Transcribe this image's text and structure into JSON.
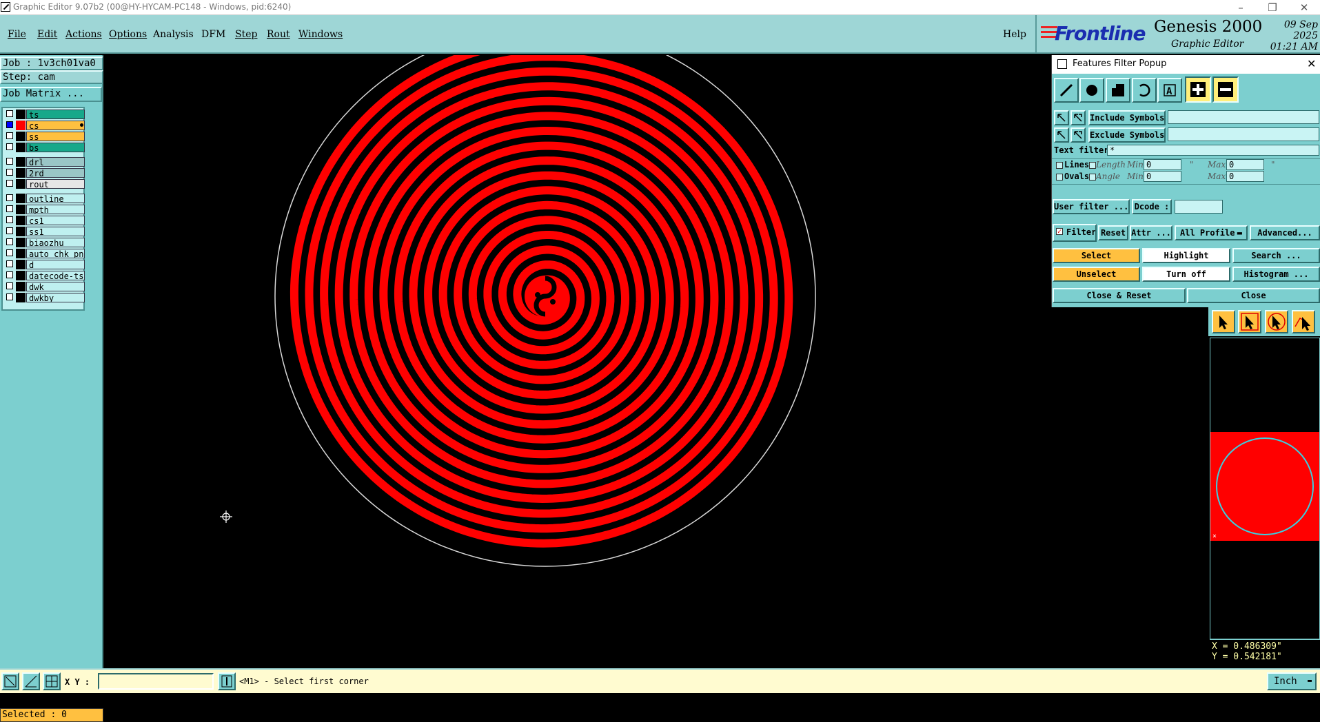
{
  "window": {
    "title": "Graphic Editor 9.07b2 (00@HY-HYCAM-PC148 - Windows, pid:6240)",
    "controls": [
      "–",
      "❐",
      "✕"
    ]
  },
  "menubar": {
    "items": [
      "File",
      "Edit",
      "Actions",
      "Options",
      "Analysis",
      "DFM",
      "Step",
      "Rout",
      "Windows"
    ],
    "help": "Help"
  },
  "logo": {
    "brand": "Frontline",
    "product": "Genesis 2000",
    "subtitle": "Graphic Editor",
    "date": "09 Sep 2025",
    "time": "01:21 AM"
  },
  "job": {
    "job_label": "Job : 1v3ch01va0",
    "step_label": "Step: cam",
    "matrix_button": "Job Matrix ..."
  },
  "layers": [
    {
      "name": "ts",
      "color": "#17a88a",
      "checked": false,
      "group": 0
    },
    {
      "name": "cs",
      "color": "#ffc040",
      "checked": true,
      "work": true,
      "group": 0
    },
    {
      "name": "ss",
      "color": "#ffc040",
      "checked": false,
      "group": 0
    },
    {
      "name": "bs",
      "color": "#17a88a",
      "checked": false,
      "group": 0
    },
    {
      "name": "drl",
      "color": "#9ac6c6",
      "checked": false,
      "group": 1
    },
    {
      "name": "2rd",
      "color": "#9ac6c6",
      "checked": false,
      "group": 1
    },
    {
      "name": "rout",
      "color": "#e6e6e6",
      "checked": false,
      "group": 1
    },
    {
      "name": "outline",
      "color": "#bff0f0",
      "checked": false,
      "group": 2
    },
    {
      "name": "mpth",
      "color": "#bff0f0",
      "checked": false,
      "group": 2
    },
    {
      "name": "cs1",
      "color": "#bff0f0",
      "checked": false,
      "group": 2
    },
    {
      "name": "ss1",
      "color": "#bff0f0",
      "checked": false,
      "group": 2
    },
    {
      "name": "biaozhu",
      "color": "#bff0f0",
      "checked": false,
      "group": 2
    },
    {
      "name": "auto_chk_pn",
      "color": "#bff0f0",
      "checked": false,
      "group": 2
    },
    {
      "name": "d",
      "color": "#bff0f0",
      "checked": false,
      "group": 2
    },
    {
      "name": "datecode-ts",
      "color": "#bff0f0",
      "checked": false,
      "group": 2
    },
    {
      "name": "dwk",
      "color": "#bff0f0",
      "checked": false,
      "group": 2
    },
    {
      "name": "dwkby",
      "color": "#bff0f0",
      "checked": false,
      "group": 2
    }
  ],
  "selected_label": "Selected : 0",
  "features_filter": {
    "title": "Features Filter Popup",
    "feature_types": [
      "line-icon",
      "pad-icon",
      "surface-icon",
      "arc-icon",
      "text-icon"
    ],
    "polarity": [
      "plus-icon",
      "minus-icon"
    ],
    "include_symbols_label": "Include Symbols :",
    "include_symbols_value": "",
    "exclude_symbols_label": "Exclude Symbols :",
    "exclude_symbols_value": "",
    "text_filter_label": "Text filter",
    "text_filter_value": "*",
    "lines_label": "Lines",
    "ovals_label": "Ovals",
    "length_label": "Length",
    "angle_label": "Angle",
    "min_label": "Min:",
    "max_label": "Max:",
    "length_min": "0",
    "length_max": "0",
    "angle_min": "0",
    "angle_max": "0",
    "inch_mark": "\"",
    "user_filter": "User filter ...",
    "dcode_label": "Dcode :",
    "dcode_value": "",
    "filter_label": "Filter",
    "filter_checked": true,
    "reset": "Reset",
    "attr": "Attr ...",
    "profile": "All Profile",
    "advanced": "Advanced...",
    "select": "Select",
    "highlight": "Highlight",
    "search": "Search ...",
    "unselect": "Unselect",
    "turn_off": "Turn off",
    "histogram": "Histogram ...",
    "close_reset": "Close & Reset",
    "close": "Close"
  },
  "right_tools": [
    "pointer-icon",
    "select-pointer-icon",
    "rotate-pointer-icon",
    "snap-pointer-icon"
  ],
  "coords": {
    "x": "X = 0.486309\"",
    "y": "Y = 0.542181\""
  },
  "statusbar": {
    "xy_label": "X Y :",
    "xy_value": "",
    "message": "<M1> - Select first corner",
    "units": "Inch"
  },
  "colors": {
    "feature": "#ff0000",
    "profile": "#d8d8d8",
    "panel": "#7ccfcf",
    "menubar": "#9ed6d6",
    "highlight_button": "#ffc040"
  }
}
